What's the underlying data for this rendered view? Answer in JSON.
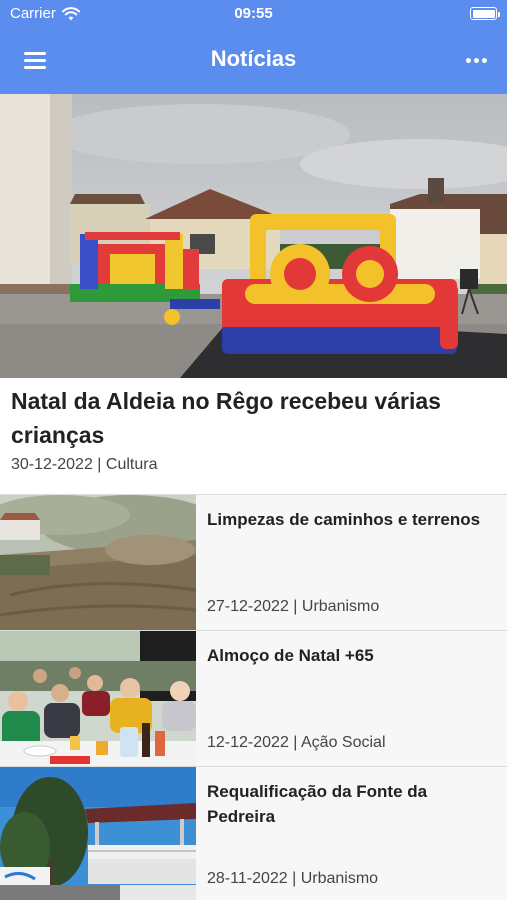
{
  "status_bar": {
    "carrier": "Carrier",
    "time": "09:55"
  },
  "header": {
    "title": "Notícias"
  },
  "featured": {
    "title": "Natal da Aldeia no Rêgo recebeu várias crianças",
    "meta": "30-12-2022 | Cultura"
  },
  "news": [
    {
      "title": "Limpezas de caminhos e terrenos",
      "meta": "27-12-2022 | Urbanismo"
    },
    {
      "title": "Almoço de Natal +65",
      "meta": "12-12-2022 | Ação Social"
    },
    {
      "title": "Requalificação da Fonte da Pedreira",
      "meta": "28-11-2022 | Urbanismo"
    }
  ],
  "colors": {
    "header": "#5b8def",
    "text": "#222222",
    "meta": "#444444",
    "divider": "#dcdcdc"
  },
  "icons": {
    "menu": "hamburger-menu-icon",
    "more": "more-dots-icon",
    "wifi": "wifi-icon",
    "battery": "battery-icon"
  }
}
